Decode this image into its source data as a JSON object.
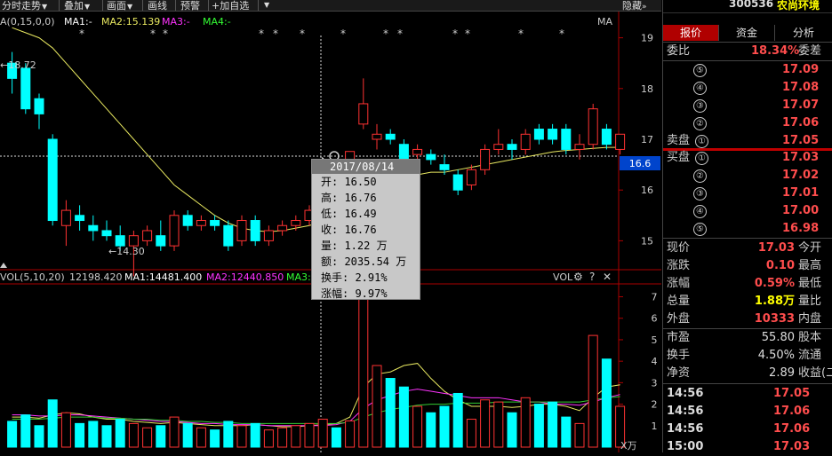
{
  "toolbar": {
    "items": [
      "分时走势",
      "叠加",
      "画面",
      "画线",
      "预警",
      "+加自选"
    ],
    "hide_label": "隐藏"
  },
  "kline": {
    "title": "A(0,15,0,0)",
    "ma1_label": "MA1:-",
    "ma2_label": "MA2:15.139",
    "ma3_label": "MA3:-",
    "ma4_label": "MA4:-",
    "ma_right": "MA",
    "high_mark": "←18.72",
    "low_mark": "←14.30",
    "current_price_tag": "16.6",
    "y_ticks": [
      "19",
      "18",
      "17",
      "16",
      "15"
    ]
  },
  "volume": {
    "title": "VOL(5,10,20)",
    "vol_value": "12198.420",
    "ma1_label": "MA1:14481.400",
    "ma2_label": "MA2:12440.850",
    "ma3_label": "MA3:1",
    "panel_label": "VOL",
    "unit": "X万",
    "y_ticks": [
      "7",
      "6",
      "5",
      "4",
      "3",
      "2",
      "1"
    ]
  },
  "tooltip": {
    "date": "2017/08/14",
    "open": "开: 16.50",
    "high": "高: 16.76",
    "low": "低: 16.49",
    "close": "收: 16.76",
    "volume": "量: 1.22 万",
    "amount": "额: 2035.54 万",
    "turnover": "换手: 2.91%",
    "change": "涨幅: 9.97%"
  },
  "stock": {
    "code": "300536",
    "name": "农尚环境"
  },
  "tabs": [
    "报价",
    "资金",
    "分析"
  ],
  "order_book": {
    "ratio_label": "委比",
    "ratio_value": "18.34%",
    "diff_label": "委差",
    "sell_label": "卖盘",
    "buy_label": "买盘",
    "sells": [
      {
        "n": "⑤",
        "p": "17.09"
      },
      {
        "n": "④",
        "p": "17.08"
      },
      {
        "n": "③",
        "p": "17.07"
      },
      {
        "n": "②",
        "p": "17.06"
      },
      {
        "n": "①",
        "p": "17.05"
      }
    ],
    "buys": [
      {
        "n": "①",
        "p": "17.03"
      },
      {
        "n": "②",
        "p": "17.02"
      },
      {
        "n": "③",
        "p": "17.01"
      },
      {
        "n": "④",
        "p": "17.00"
      },
      {
        "n": "⑤",
        "p": "16.98"
      }
    ]
  },
  "quote": [
    {
      "l": "现价",
      "v": "17.03",
      "r": "今开",
      "c": "red"
    },
    {
      "l": "涨跌",
      "v": "0.10",
      "r": "最高",
      "c": "red"
    },
    {
      "l": "涨幅",
      "v": "0.59%",
      "r": "最低",
      "c": "red"
    },
    {
      "l": "总量",
      "v": "1.88万",
      "r": "量比",
      "c": "yel"
    },
    {
      "l": "外盘",
      "v": "10333",
      "r": "内盘",
      "c": "red"
    }
  ],
  "fundamentals": [
    {
      "l": "市盈",
      "v": "55.80",
      "r": "股本"
    },
    {
      "l": "换手",
      "v": "4.50%",
      "r": "流通"
    },
    {
      "l": "净资",
      "v": "2.89",
      "r": "收益(二"
    }
  ],
  "ticks": [
    {
      "t": "14:56",
      "p": "17.05"
    },
    {
      "t": "14:56",
      "p": "17.06"
    },
    {
      "t": "14:56",
      "p": "17.06"
    },
    {
      "t": "15:00",
      "p": "17.03"
    }
  ],
  "chart_data": {
    "type": "candlestick",
    "y_range": [
      14.5,
      19.5
    ],
    "vol_range": [
      0,
      7.6
    ],
    "candles": [
      {
        "o": 18.5,
        "c": 18.2,
        "h": 18.72,
        "l": 17.9,
        "v": 1.2
      },
      {
        "o": 18.4,
        "c": 17.6,
        "h": 18.5,
        "l": 17.5,
        "v": 1.5
      },
      {
        "o": 17.8,
        "c": 17.5,
        "h": 17.9,
        "l": 17.2,
        "v": 1.0
      },
      {
        "o": 17.0,
        "c": 15.4,
        "h": 17.1,
        "l": 15.3,
        "v": 2.2
      },
      {
        "o": 15.3,
        "c": 15.6,
        "h": 15.8,
        "l": 14.9,
        "v": 1.6
      },
      {
        "o": 15.5,
        "c": 15.4,
        "h": 15.7,
        "l": 15.2,
        "v": 1.1
      },
      {
        "o": 15.3,
        "c": 15.2,
        "h": 15.5,
        "l": 15.0,
        "v": 1.2
      },
      {
        "o": 15.2,
        "c": 15.1,
        "h": 15.4,
        "l": 15.0,
        "v": 1.0
      },
      {
        "o": 15.1,
        "c": 14.9,
        "h": 15.3,
        "l": 14.8,
        "v": 1.3
      },
      {
        "o": 14.9,
        "c": 15.1,
        "h": 15.2,
        "l": 14.3,
        "v": 1.1
      },
      {
        "o": 15.0,
        "c": 15.2,
        "h": 15.3,
        "l": 14.9,
        "v": 0.9
      },
      {
        "o": 15.1,
        "c": 14.9,
        "h": 15.4,
        "l": 14.8,
        "v": 1.0
      },
      {
        "o": 14.9,
        "c": 15.5,
        "h": 15.6,
        "l": 14.8,
        "v": 1.4
      },
      {
        "o": 15.5,
        "c": 15.3,
        "h": 15.6,
        "l": 15.2,
        "v": 1.1
      },
      {
        "o": 15.3,
        "c": 15.4,
        "h": 15.5,
        "l": 15.2,
        "v": 0.9
      },
      {
        "o": 15.4,
        "c": 15.3,
        "h": 15.5,
        "l": 15.2,
        "v": 0.8
      },
      {
        "o": 15.3,
        "c": 14.9,
        "h": 15.4,
        "l": 14.8,
        "v": 1.2
      },
      {
        "o": 15.0,
        "c": 15.4,
        "h": 15.5,
        "l": 14.9,
        "v": 1.0
      },
      {
        "o": 15.4,
        "c": 15.0,
        "h": 15.5,
        "l": 14.9,
        "v": 1.1
      },
      {
        "o": 15.0,
        "c": 15.2,
        "h": 15.3,
        "l": 14.9,
        "v": 0.8
      },
      {
        "o": 15.2,
        "c": 15.3,
        "h": 15.4,
        "l": 15.1,
        "v": 0.9
      },
      {
        "o": 15.3,
        "c": 15.4,
        "h": 15.5,
        "l": 15.2,
        "v": 1.0
      },
      {
        "o": 15.4,
        "c": 15.6,
        "h": 15.7,
        "l": 15.3,
        "v": 1.1
      },
      {
        "o": 15.6,
        "c": 15.8,
        "h": 16.0,
        "l": 15.5,
        "v": 1.3
      },
      {
        "o": 15.7,
        "c": 15.6,
        "h": 15.9,
        "l": 15.5,
        "v": 0.9
      },
      {
        "o": 16.5,
        "c": 16.76,
        "h": 16.76,
        "l": 16.49,
        "v": 1.22
      },
      {
        "o": 17.3,
        "c": 17.7,
        "h": 18.2,
        "l": 17.2,
        "v": 7.2
      },
      {
        "o": 17.0,
        "c": 17.1,
        "h": 17.3,
        "l": 16.8,
        "v": 3.8
      },
      {
        "o": 17.1,
        "c": 17.0,
        "h": 17.2,
        "l": 16.9,
        "v": 3.2
      },
      {
        "o": 16.9,
        "c": 16.6,
        "h": 17.0,
        "l": 16.5,
        "v": 2.8
      },
      {
        "o": 16.7,
        "c": 16.8,
        "h": 16.9,
        "l": 16.5,
        "v": 1.9
      },
      {
        "o": 16.7,
        "c": 16.6,
        "h": 16.8,
        "l": 16.5,
        "v": 1.6
      },
      {
        "o": 16.5,
        "c": 16.4,
        "h": 16.7,
        "l": 16.3,
        "v": 1.9
      },
      {
        "o": 16.3,
        "c": 16.0,
        "h": 16.4,
        "l": 15.9,
        "v": 2.5
      },
      {
        "o": 16.1,
        "c": 16.4,
        "h": 16.5,
        "l": 16.0,
        "v": 1.3
      },
      {
        "o": 16.4,
        "c": 16.8,
        "h": 16.9,
        "l": 16.3,
        "v": 2.2
      },
      {
        "o": 16.8,
        "c": 16.9,
        "h": 17.2,
        "l": 16.7,
        "v": 2.1
      },
      {
        "o": 16.9,
        "c": 16.8,
        "h": 17.0,
        "l": 16.6,
        "v": 1.6
      },
      {
        "o": 16.8,
        "c": 17.1,
        "h": 17.2,
        "l": 16.7,
        "v": 2.3
      },
      {
        "o": 17.2,
        "c": 17.0,
        "h": 17.3,
        "l": 16.9,
        "v": 2.0
      },
      {
        "o": 17.2,
        "c": 17.0,
        "h": 17.3,
        "l": 16.9,
        "v": 2.1
      },
      {
        "o": 17.2,
        "c": 16.8,
        "h": 17.3,
        "l": 16.7,
        "v": 1.4
      },
      {
        "o": 16.8,
        "c": 16.9,
        "h": 17.1,
        "l": 16.6,
        "v": 1.1
      },
      {
        "o": 16.9,
        "c": 17.6,
        "h": 17.7,
        "l": 16.8,
        "v": 5.2
      },
      {
        "o": 17.2,
        "c": 16.9,
        "h": 17.3,
        "l": 16.8,
        "v": 4.1
      },
      {
        "o": 16.8,
        "c": 17.1,
        "h": 17.1,
        "l": 16.7,
        "v": 1.9
      }
    ],
    "ma2": [
      19.2,
      19.1,
      19.0,
      18.8,
      18.5,
      18.2,
      17.9,
      17.6,
      17.3,
      17.0,
      16.7,
      16.4,
      16.1,
      15.9,
      15.7,
      15.5,
      15.35,
      15.25,
      15.2,
      15.18,
      15.2,
      15.25,
      15.3,
      15.38,
      15.45,
      15.6,
      15.75,
      15.9,
      16.05,
      16.2,
      16.3,
      16.35,
      16.35,
      16.4,
      16.45,
      16.5,
      16.55,
      16.6,
      16.65,
      16.7,
      16.75,
      16.78,
      16.8,
      16.82,
      16.84,
      16.84
    ],
    "vol_ma": [
      [
        1.4,
        1.4,
        1.35,
        1.5,
        1.6,
        1.55,
        1.4,
        1.3,
        1.3,
        1.2,
        1.15,
        1.1,
        1.15,
        1.1,
        1.05,
        1.0,
        1.0,
        1.0,
        1.05,
        1.0,
        0.95,
        0.95,
        1.0,
        1.05,
        1.1,
        1.4,
        2.8,
        3.4,
        3.5,
        3.8,
        3.9,
        3.2,
        2.6,
        2.2,
        1.9,
        1.9,
        1.9,
        1.85,
        1.9,
        2.0,
        2.0,
        1.9,
        1.7,
        2.3,
        2.8,
        2.9
      ],
      [
        1.5,
        1.5,
        1.45,
        1.45,
        1.5,
        1.5,
        1.45,
        1.4,
        1.35,
        1.3,
        1.25,
        1.2,
        1.2,
        1.15,
        1.1,
        1.1,
        1.05,
        1.05,
        1.05,
        1.0,
        1.0,
        1.0,
        1.0,
        1.0,
        1.05,
        1.2,
        1.8,
        2.2,
        2.4,
        2.6,
        2.7,
        2.6,
        2.5,
        2.4,
        2.3,
        2.3,
        2.3,
        2.2,
        2.1,
        2.1,
        2.0,
        2.0,
        1.95,
        2.1,
        2.3,
        2.45
      ],
      [
        1.3,
        1.3,
        1.3,
        1.35,
        1.4,
        1.4,
        1.4,
        1.35,
        1.35,
        1.3,
        1.3,
        1.25,
        1.25,
        1.2,
        1.2,
        1.15,
        1.15,
        1.1,
        1.1,
        1.1,
        1.1,
        1.1,
        1.1,
        1.1,
        1.1,
        1.15,
        1.4,
        1.6,
        1.75,
        1.85,
        1.95,
        2.0,
        2.0,
        2.05,
        2.05,
        2.05,
        2.1,
        2.1,
        2.1,
        2.1,
        2.1,
        2.1,
        2.1,
        2.2,
        2.3,
        2.35
      ]
    ]
  }
}
